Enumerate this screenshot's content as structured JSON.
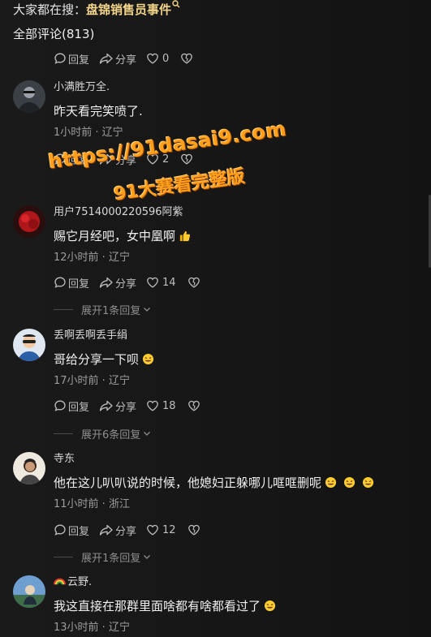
{
  "search": {
    "prefix": "大家都在搜：",
    "term": "盘锦销售员事件"
  },
  "comments_title": "全部评论(813)",
  "top_actions": {
    "reply": "回复",
    "share": "分享",
    "likes": "0"
  },
  "comments": [
    {
      "username": "小满胜万全.",
      "text": "昨天看完笑喷了.",
      "meta": "1小时前 · 辽宁",
      "reply": "回复",
      "share": "分享",
      "likes": "2"
    },
    {
      "username": "用户7514000220596阿紫",
      "text": "赐它月经吧，女中凰啊",
      "meta": "12小时前 · 辽宁",
      "reply": "回复",
      "share": "分享",
      "likes": "14",
      "expand": "展开1条回复"
    },
    {
      "username": "丢啊丢啊丢手绢",
      "text": "哥给分享一下呗",
      "meta": "17小时前 · 辽宁",
      "reply": "回复",
      "share": "分享",
      "likes": "18",
      "expand": "展开6条回复"
    },
    {
      "username": "寺东",
      "text": "他在这儿叭叭说的时候，他媳妇正躲哪儿哐哐删呢",
      "meta": "11小时前 · 浙江",
      "reply": "回复",
      "share": "分享",
      "likes": "12",
      "expand": "展开1条回复"
    },
    {
      "username": "云野.",
      "text": "我这直接在那群里面啥都有啥都看过了",
      "meta": "13小时前 · 辽宁"
    }
  ],
  "watermark": {
    "line1": "https://91dasai9.com",
    "line2": "91大赛看完整版"
  },
  "icons": {
    "reply": "reply-bubble-icon",
    "share": "share-arrow-icon",
    "like": "heart-icon",
    "dislike": "broken-heart-icon",
    "thumbs_up_emoji": "thumbs-up-emoji",
    "laughing_emoji": "rolling-laughing-emoji",
    "rainbow_emoji": "rainbow-emoji"
  },
  "colors": {
    "background": "#161616",
    "search_term": "#f2d48a",
    "watermark": "#ff9f1c",
    "meta_text": "#9c9c9c"
  }
}
